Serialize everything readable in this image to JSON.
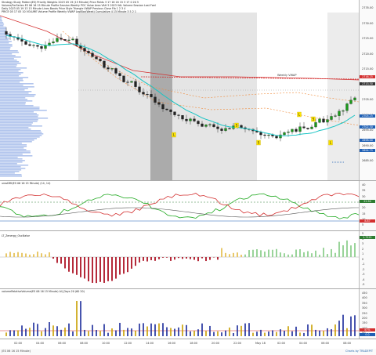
{
  "price_pane": {
    "header_lines": [
      "Strategy  Study  Pattern(ES)  Priority Weights  2023 05 19 (15 Minute)  Price Fields  3 17 18 20 15 3 17 0 20 5",
      "Volume/ForSeries  ES 06 16 15 Minute Profile  Session  Weekly POC Value Area  VAH 5 2023  VAL  Volume  Session  Last  Fwd",
      "Daily 2023 05 19 13 15 Minute  Lines  Bands  Price Style  Triangle  VWAP  Previous Close  Fib 1 2 3 4",
      "PRICE 05 17 05 10 VOLUME  Volume Profile  Weekly VWAP  LastBar(Week)  Cumulative 4 15 Minute 3 5 2 1"
    ],
    "price_ticks": [
      "2735.00",
      "2730.00",
      "2725.00",
      "2720.00",
      "2715.00",
      "2710.00",
      "2705.00",
      "2700.00",
      "2695.00",
      "2690.00",
      "2685.00"
    ],
    "tags": [
      {
        "label": "2716.25",
        "color": "#d32f2f"
      },
      {
        "label": "2713.50",
        "color": "#333333"
      },
      {
        "label": "2705.25",
        "color": "#1e5fb4"
      },
      {
        "label": "2702.50",
        "color": "#1e5fb4"
      },
      {
        "label": "2698.00",
        "color": "#1e5fb4"
      },
      {
        "label": "2694.75",
        "color": "#1e5fb4"
      }
    ],
    "annotation": "Weekly VWAP",
    "markers": [
      "L",
      "S",
      "S",
      "L",
      "S",
      "L"
    ]
  },
  "osc_pane": {
    "header": "urosDMI(ES 06 16 15 Minute) (14, 14)",
    "ticks": [
      "40",
      "35",
      "30",
      "25",
      "20",
      "15",
      "10",
      "5"
    ],
    "tags": [
      {
        "label": "22.94",
        "color": "#2e7d32"
      },
      {
        "label": "8.87",
        "color": "#d32f2f"
      }
    ]
  },
  "macd_pane": {
    "header": "LT_Zenergy_Oscillator",
    "ticks": [
      "5",
      "4",
      "3",
      "2",
      "1",
      "0",
      "-1",
      "-2",
      "-3",
      "-4",
      "-5"
    ],
    "tags": [
      {
        "label": "1.7121",
        "color": "#2e7d32"
      }
    ]
  },
  "volume_pane": {
    "header": "volumeRelativeVolume(ES 06 16 15 Minute) All_Days 20 (60 20)",
    "ticks": [
      "450",
      "400",
      "350",
      "300",
      "250",
      "200",
      "150",
      "100",
      "50"
    ],
    "tags": [
      {
        "label": "87%",
        "color": "#d32f2f"
      },
      {
        "label": "0.0",
        "color": "#1e5fb4"
      }
    ]
  },
  "time_axis": {
    "labels": [
      "02:00",
      "04:00",
      "06:00",
      "08:00",
      "10:00",
      "12:00",
      "14:00",
      "16:00",
      "18:00",
      "20:00",
      "22:00",
      "May 18",
      "02:00",
      "04:00",
      "06:00",
      "08:00"
    ]
  },
  "footer": {
    "left": "(ES 06 16 15 Minute)",
    "right": "Charts by TRADEPIT"
  },
  "colors": {
    "up": "#1a9b1a",
    "down": "#222222",
    "ema_cyan": "#19c4c4",
    "resistance_red": "#d32f2f",
    "orange_dash": "#ef8a3a",
    "shade": "#cfcfcf",
    "shade_dark": "#8f8f8f",
    "dmi_green": "#22aa22",
    "dmi_red": "#d32f2f",
    "osc_pos": "#e8c86a",
    "osc_neg": "#b52a3a",
    "vol_bar": "#1a2a9b"
  }
}
